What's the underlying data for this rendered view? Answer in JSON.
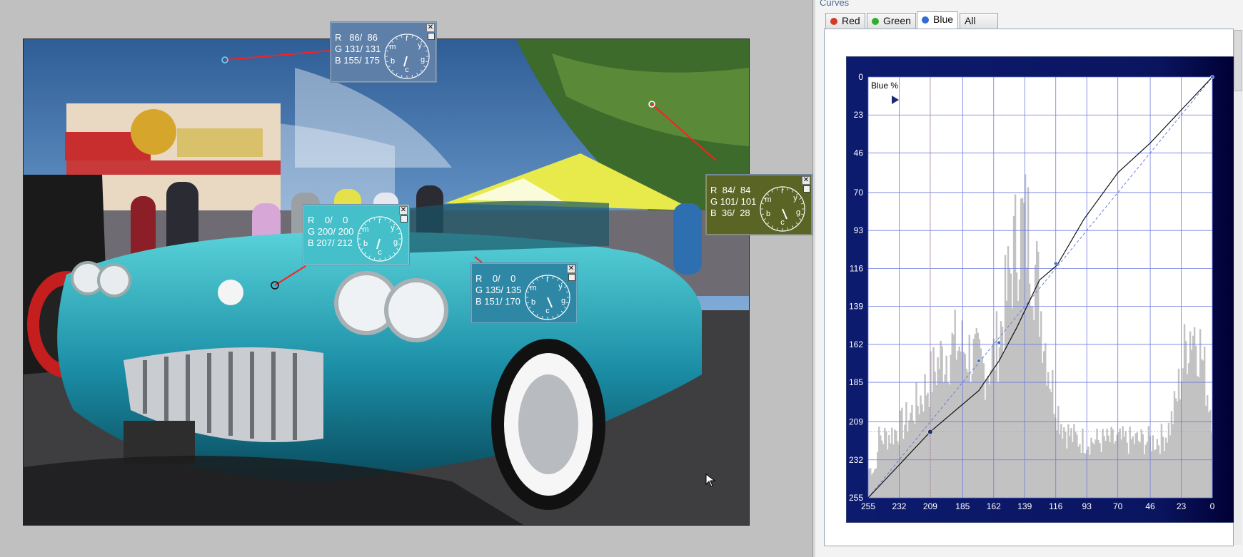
{
  "panel": {
    "title": "Curves",
    "tabs": [
      {
        "label": "Red",
        "color": "#d23b2b"
      },
      {
        "label": "Green",
        "color": "#2fae2f"
      },
      {
        "label": "Blue",
        "color": "#2f6cd8"
      },
      {
        "label": "All"
      }
    ],
    "active_tab": "Blue"
  },
  "probes": [
    {
      "r": "R   86/  86",
      "g": "G 131/ 131",
      "b": "B 155/ 175",
      "bg": "#5d7fa8",
      "hand": "pointer"
    },
    {
      "r": "R  84/  84",
      "g": "G 101/ 101",
      "b": "B  36/  28",
      "bg": "#5a6424",
      "hand": "pointer"
    },
    {
      "r": "R    0/    0",
      "g": "G 200/ 200",
      "b": "B 207/ 212",
      "bg": "#45bfc9",
      "hand": "pointer"
    },
    {
      "r": "R    0/    0",
      "g": "G 135/ 135",
      "b": "B 151/ 170",
      "bg": "#2f87a6",
      "hand": "pointer"
    }
  ],
  "dial_labels": [
    "r",
    "y",
    "g",
    "c",
    "b",
    "m"
  ],
  "chart_data": {
    "type": "line",
    "title": "Blue %",
    "x_ticks": [
      "255",
      "232",
      "209",
      "185",
      "162",
      "139",
      "116",
      "93",
      "70",
      "46",
      "23",
      "0"
    ],
    "y_ticks": [
      "0",
      "23",
      "46",
      "70",
      "93",
      "116",
      "139",
      "162",
      "185",
      "209",
      "232",
      "255"
    ],
    "xlim": [
      255,
      0
    ],
    "ylim": [
      0,
      255
    ],
    "grid": true,
    "series": [
      {
        "values_x": [
          255,
          209,
          173,
          158,
          145,
          128,
          115,
          95,
          70,
          46,
          23,
          0
        ],
        "values_y": [
          255,
          215,
          190,
          172,
          152,
          123,
          114,
          86,
          58,
          40,
          20,
          0
        ]
      }
    ],
    "control_points": [
      {
        "x": 209,
        "y": 215
      },
      {
        "x": 173,
        "y": 172
      },
      {
        "x": 158,
        "y": 161
      },
      {
        "x": 116,
        "y": 113
      },
      {
        "x": 0,
        "y": 0
      }
    ]
  }
}
